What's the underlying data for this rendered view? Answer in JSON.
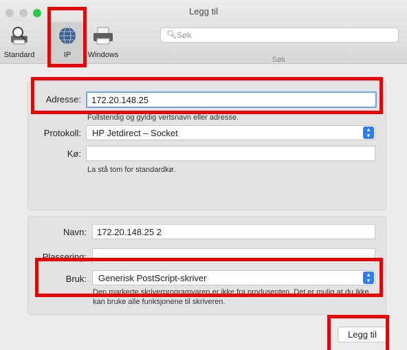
{
  "window": {
    "title": "Legg til"
  },
  "toolbar": {
    "items": [
      {
        "label": "Standard",
        "icon": "printer-search-icon"
      },
      {
        "label": "IP",
        "icon": "globe-icon"
      },
      {
        "label": "Windows",
        "icon": "printer-icon"
      }
    ],
    "search": {
      "placeholder": "Søk",
      "caption": "Søk"
    }
  },
  "ip_panel": {
    "address_label": "Adresse:",
    "address_value": "172.20.148.25",
    "address_hint": "Fullstendig og gyldig vertsnavn eller adresse.",
    "protocol_label": "Protokoll:",
    "protocol_value": "HP Jetdirect – Socket",
    "queue_label": "Kø:",
    "queue_value": "",
    "queue_hint": "La stå tom for standardkø."
  },
  "info_panel": {
    "name_label": "Navn:",
    "name_value": "172.20.148.25 2",
    "location_label": "Plassering:",
    "location_value": "",
    "use_label": "Bruk:",
    "use_value": "Generisk PostScript-skriver",
    "use_hint": "Den markerte skriverprogramvaren er ikke fra produsenten. Det er mulig at du ikke kan bruke alle funksjonene til skriveren."
  },
  "footer": {
    "add_button": "Legg til"
  },
  "colors": {
    "highlight": "#ee0000",
    "accent": "#2f7cf6"
  }
}
